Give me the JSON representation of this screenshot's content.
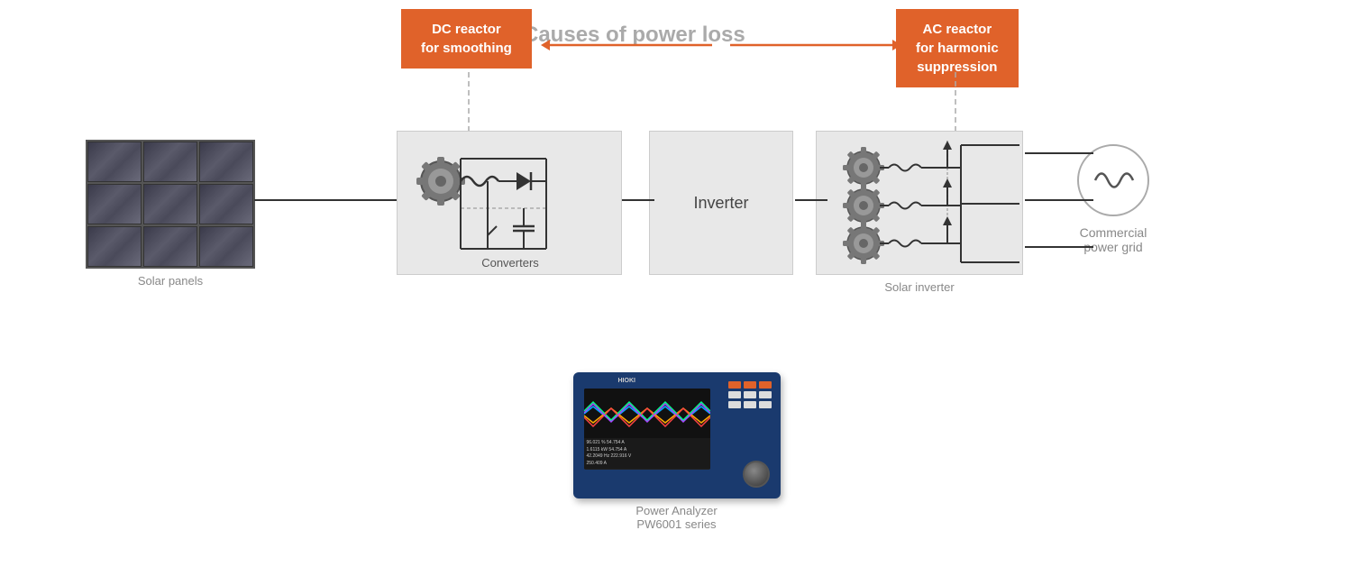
{
  "title": "Causes of power loss",
  "boxes": {
    "dc_reactor": {
      "line1": "DC reactor",
      "line2": "for smoothing"
    },
    "ac_reactor": {
      "line1": "AC reactor",
      "line2": "for harmonic",
      "line3": "suppression"
    }
  },
  "components": {
    "solar_panels": "Solar panels",
    "converters": "Converters",
    "inverter": "Inverter",
    "solar_inverter": "Solar inverter",
    "commercial_power_grid": "Commercial\npower grid"
  },
  "instrument": {
    "brand": "HIOKI",
    "label1": "Power Analyzer",
    "label2": "PW6001 series"
  },
  "screen_data": [
    "96.021 %    54.754 A",
    "1.6115 kW   54.754 A",
    "42.2049 Hz  222.916 V",
    "            250.409 A"
  ],
  "colors": {
    "orange": "#E0622A",
    "light_gray": "#e8e8e8",
    "mid_gray": "#888",
    "dark_blue": "#1a3a6e"
  }
}
